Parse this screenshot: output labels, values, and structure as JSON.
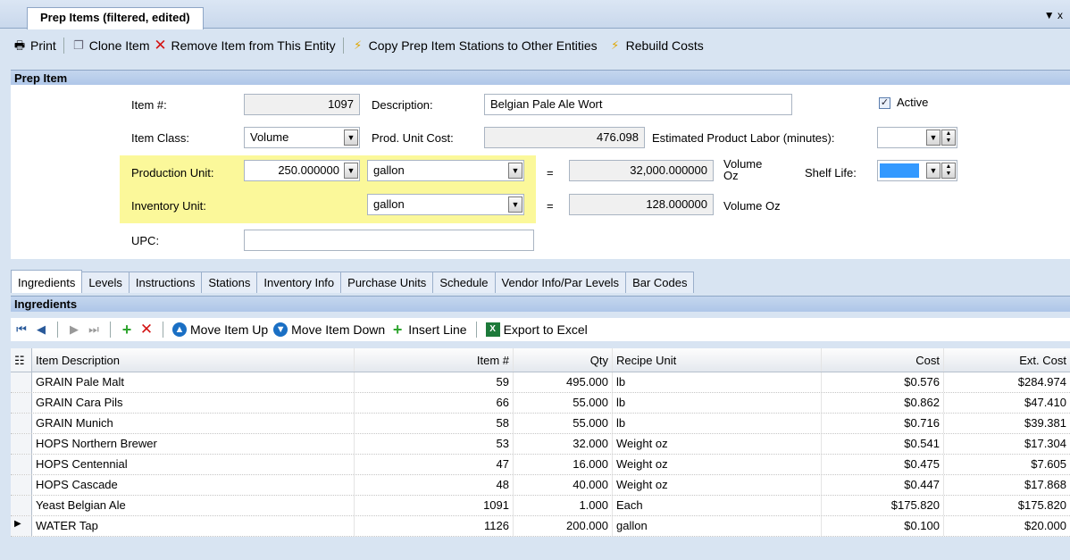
{
  "window": {
    "tab_title": "Prep Items (filtered, edited)",
    "menu_glyph": "▼ x"
  },
  "toolbar": {
    "print": "Print",
    "clone": "Clone Item",
    "remove": "Remove Item from This Entity",
    "copy_stations": "Copy Prep Item Stations to Other Entities",
    "rebuild": "Rebuild Costs"
  },
  "prep_item": {
    "header": "Prep Item",
    "item_no_label": "Item #:",
    "item_no": "1097",
    "description_label": "Description:",
    "description": "Belgian Pale Ale Wort",
    "active_label": "Active",
    "item_class_label": "Item Class:",
    "item_class": "Volume",
    "prod_unit_cost_label": "Prod. Unit Cost:",
    "prod_unit_cost": "476.098",
    "labor_label": "Estimated Product Labor (minutes):",
    "production_unit_label": "Production Unit:",
    "production_qty": "250.000000",
    "production_unit": "gallon",
    "production_equals": "=",
    "production_converted": "32,000.000000",
    "production_converted_unit_line1": "Volume",
    "production_converted_unit_line2": "Oz",
    "shelf_life_label": "Shelf Life:",
    "inventory_unit_label": "Inventory Unit:",
    "inventory_unit": "gallon",
    "inventory_equals": "=",
    "inventory_converted": "128.000000",
    "inventory_converted_unit": "Volume Oz",
    "upc_label": "UPC:",
    "upc": ""
  },
  "subtabs": [
    "Ingredients",
    "Levels",
    "Instructions",
    "Stations",
    "Inventory Info",
    "Purchase Units",
    "Schedule",
    "Vendor Info/Par Levels",
    "Bar Codes"
  ],
  "ingredients": {
    "header": "Ingredients",
    "toolbar": {
      "move_up": "Move Item Up",
      "move_down": "Move Item Down",
      "insert_line": "Insert Line",
      "export": "Export to Excel"
    },
    "columns": [
      "Item Description",
      "Item #",
      "Qty",
      "Recipe Unit",
      "Cost",
      "Ext. Cost"
    ],
    "rows": [
      {
        "desc": "GRAIN Pale Malt",
        "item": "59",
        "qty": "495.000",
        "unit": "lb",
        "cost": "$0.576",
        "ext": "$284.974"
      },
      {
        "desc": "GRAIN Cara Pils",
        "item": "66",
        "qty": "55.000",
        "unit": "lb",
        "cost": "$0.862",
        "ext": "$47.410"
      },
      {
        "desc": "GRAIN Munich",
        "item": "58",
        "qty": "55.000",
        "unit": "lb",
        "cost": "$0.716",
        "ext": "$39.381"
      },
      {
        "desc": "HOPS Northern Brewer",
        "item": "53",
        "qty": "32.000",
        "unit": "Weight oz",
        "cost": "$0.541",
        "ext": "$17.304"
      },
      {
        "desc": "HOPS Centennial",
        "item": "47",
        "qty": "16.000",
        "unit": "Weight oz",
        "cost": "$0.475",
        "ext": "$7.605"
      },
      {
        "desc": "HOPS Cascade",
        "item": "48",
        "qty": "40.000",
        "unit": "Weight oz",
        "cost": "$0.447",
        "ext": "$17.868"
      },
      {
        "desc": "Yeast Belgian Ale",
        "item": "1091",
        "qty": "1.000",
        "unit": "Each",
        "cost": "$175.820",
        "ext": "$175.820"
      },
      {
        "desc": "WATER Tap",
        "item": "1126",
        "qty": "200.000",
        "unit": "gallon",
        "cost": "$0.100",
        "ext": "$20.000"
      }
    ]
  }
}
